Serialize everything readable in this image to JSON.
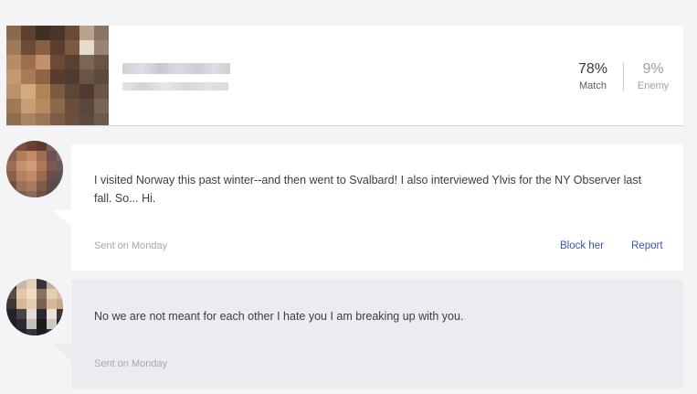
{
  "profile": {
    "stats": [
      {
        "value": "78%",
        "label": "Match"
      },
      {
        "value": "9%",
        "label": "Enemy"
      }
    ]
  },
  "messages": [
    {
      "text": "I visited Norway this past winter--and then went to Svalbard! I also interviewed Ylvis for the NY Observer last fall. So... Hi.",
      "time": "Sent on Monday",
      "actions": {
        "block": "Block her",
        "report": "Report"
      }
    },
    {
      "text": "No we are not meant for each other I hate you I am breaking up with you.",
      "time": "Sent on Monday"
    }
  ],
  "colors": {
    "background": "#f4f4f7",
    "link": "#3a56a6",
    "sent_bubble": "#ebecf0"
  }
}
